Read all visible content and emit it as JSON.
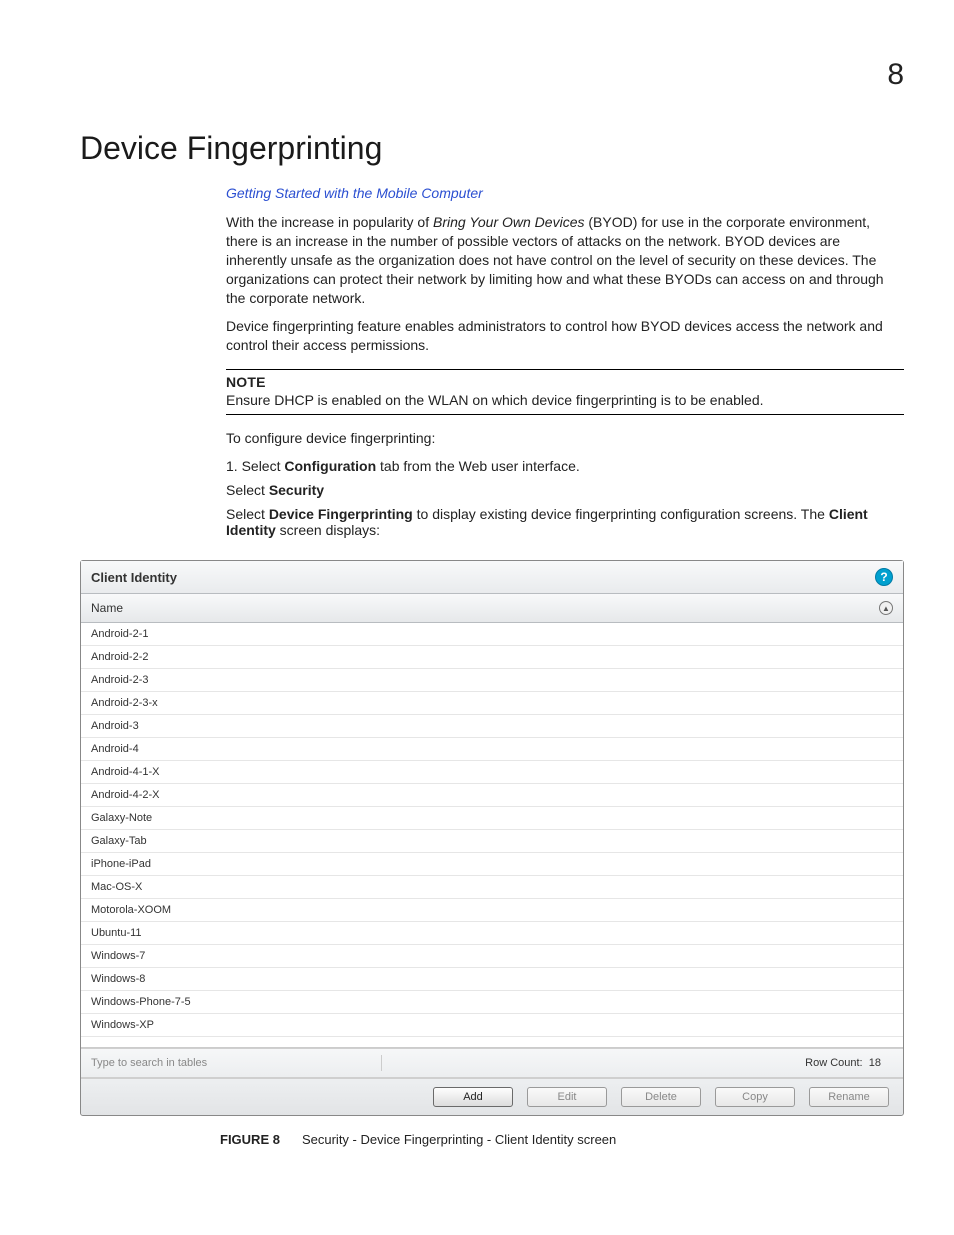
{
  "chapter_number": "8",
  "title": "Device Fingerprinting",
  "link": "Getting Started with the Mobile Computer",
  "para1_a": "With the increase in popularity of ",
  "para1_em": "Bring Your Own Devices",
  "para1_b": " (BYOD) for use in the corporate environment, there is an increase in the number of possible vectors of attacks on the network. BYOD devices are inherently unsafe as the organization does not have control on the level of security on these devices. The organizations can protect their network by limiting how and what these BYODs can access on and through the corporate network.",
  "para2": "Device fingerprinting feature enables administrators to control how BYOD devices access the network and control their access permissions.",
  "note_label": "NOTE",
  "note_text": "Ensure DHCP is enabled on the WLAN on which device fingerprinting is to be enabled.",
  "para3": "To configure device fingerprinting:",
  "step1_a": "1.    Select ",
  "step1_b": "Configuration",
  "step1_c": " tab from the Web user interface.",
  "step2_a": "Select ",
  "step2_b": "Security",
  "step3_a": "Select ",
  "step3_b": "Device Fingerprinting",
  "step3_c": " to display existing device fingerprinting configuration screens. The ",
  "step3_d": "Client Identity",
  "step3_e": " screen displays:",
  "panel": {
    "header": "Client Identity",
    "help": "?",
    "column": "Name",
    "sort_glyph": "▲",
    "rows": [
      "Android-2-1",
      "Android-2-2",
      "Android-2-3",
      "Android-2-3-x",
      "Android-3",
      "Android-4",
      "Android-4-1-X",
      "Android-4-2-X",
      "Galaxy-Note",
      "Galaxy-Tab",
      "iPhone-iPad",
      "Mac-OS-X",
      "Motorola-XOOM",
      "Ubuntu-11",
      "Windows-7",
      "Windows-8",
      "Windows-Phone-7-5",
      "Windows-XP"
    ],
    "search_placeholder": "Type to search in tables",
    "rowcount_label": "Row Count:",
    "rowcount_value": "18",
    "buttons": {
      "add": "Add",
      "edit": "Edit",
      "delete": "Delete",
      "copy": "Copy",
      "rename": "Rename"
    }
  },
  "figure": {
    "num": "FIGURE 8",
    "caption": "Security - Device Fingerprinting - Client Identity screen"
  }
}
